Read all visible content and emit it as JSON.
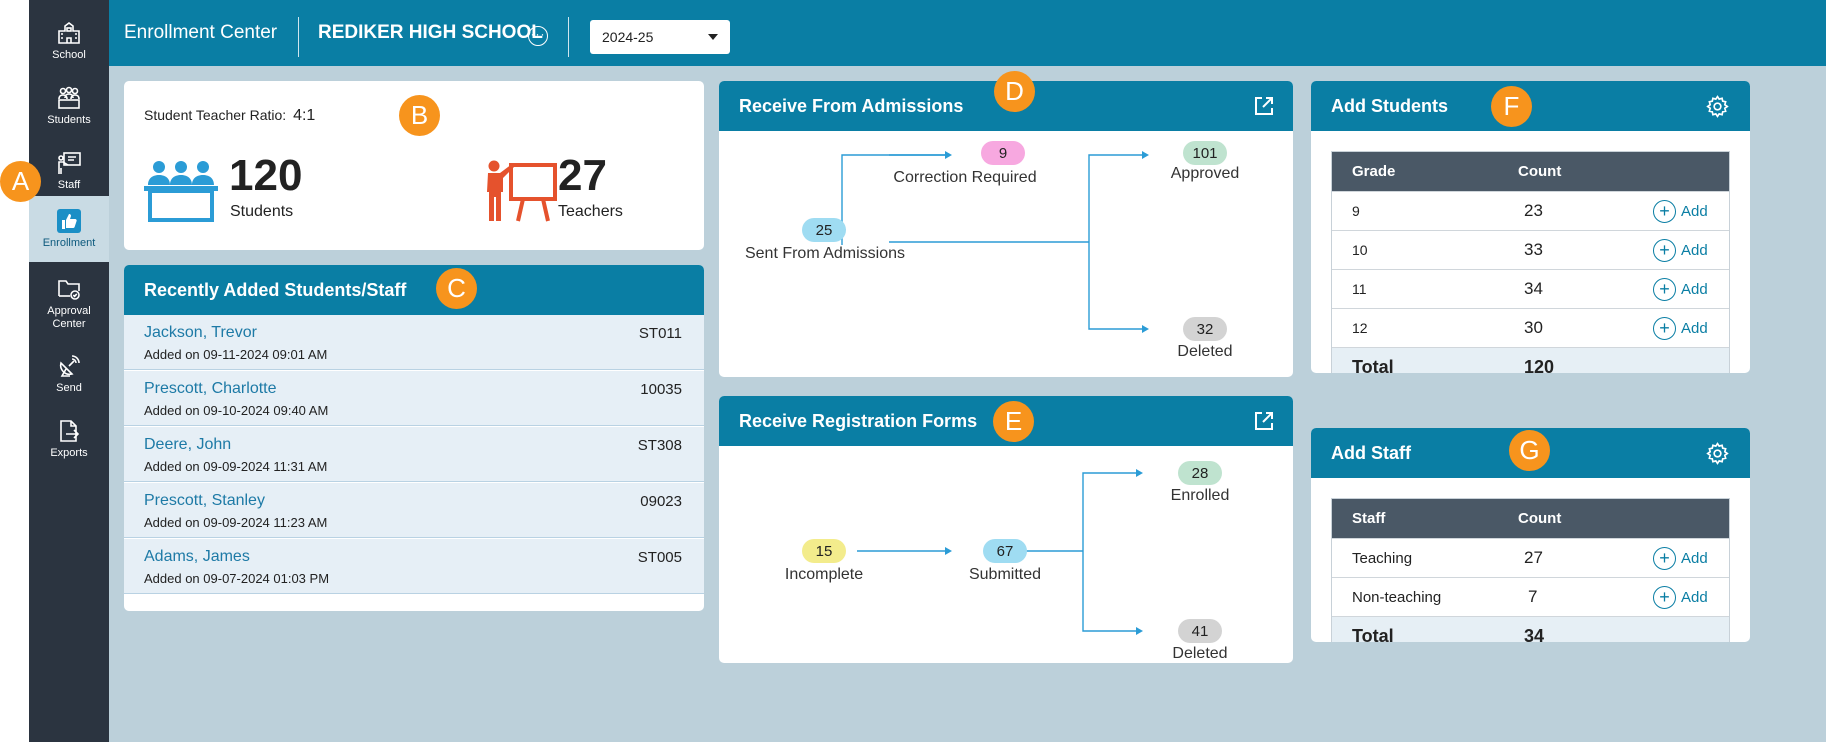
{
  "sidebar": {
    "items": [
      {
        "label": "School",
        "icon": "school-icon"
      },
      {
        "label": "Students",
        "icon": "students-icon"
      },
      {
        "label": "Staff",
        "icon": "staff-icon"
      },
      {
        "label": "Enrollment",
        "icon": "thumbs-up-icon",
        "active": true
      },
      {
        "label": "Approval\nCenter",
        "icon": "folder-check-icon"
      },
      {
        "label": "Send",
        "icon": "satellite-icon"
      },
      {
        "label": "Exports",
        "icon": "export-file-icon"
      }
    ]
  },
  "header": {
    "app_title": "Enrollment Center",
    "school_name": "REDIKER HIGH SCHOOL",
    "year_selected": "2024-25"
  },
  "badges": {
    "a": "A",
    "b": "B",
    "c": "C",
    "d": "D",
    "e": "E",
    "f": "F",
    "g": "G"
  },
  "ratio_card": {
    "ratio_label": "Student Teacher Ratio:",
    "ratio_value": "4:1",
    "students_count": "120",
    "students_label": "Students",
    "teachers_count": "27",
    "teachers_label": "Teachers"
  },
  "recent": {
    "title": "Recently Added Students/Staff",
    "rows": [
      {
        "name": "Jackson, Trevor",
        "id": "ST011",
        "added": "Added on 09-11-2024 09:01 AM"
      },
      {
        "name": "Prescott, Charlotte",
        "id": "10035",
        "added": "Added on 09-10-2024 09:40 AM"
      },
      {
        "name": "Deere, John",
        "id": "ST308",
        "added": "Added on 09-09-2024 11:31 AM"
      },
      {
        "name": "Prescott, Stanley",
        "id": "09023",
        "added": "Added on 09-09-2024 11:23 AM"
      },
      {
        "name": "Adams, James",
        "id": "ST005",
        "added": "Added on 09-07-2024 01:03 PM"
      }
    ]
  },
  "admissions": {
    "title": "Receive From Admissions",
    "correction_count": "9",
    "correction_label": "Correction Required",
    "sent_count": "25",
    "sent_label": "Sent From Admissions",
    "approved_count": "101",
    "approved_label": "Approved",
    "deleted_count": "32",
    "deleted_label": "Deleted"
  },
  "registration": {
    "title": "Receive Registration Forms",
    "incomplete_count": "15",
    "incomplete_label": "Incomplete",
    "submitted_count": "67",
    "submitted_label": "Submitted",
    "enrolled_count": "28",
    "enrolled_label": "Enrolled",
    "deleted_count": "41",
    "deleted_label": "Deleted"
  },
  "add_students": {
    "title": "Add Students",
    "col_grade": "Grade",
    "col_count": "Count",
    "rows": [
      {
        "grade": "9",
        "count": "23",
        "action": "Add"
      },
      {
        "grade": "10",
        "count": "33",
        "action": "Add"
      },
      {
        "grade": "11",
        "count": "34",
        "action": "Add"
      },
      {
        "grade": "12",
        "count": "30",
        "action": "Add"
      }
    ],
    "total_label": "Total",
    "total_value": "120"
  },
  "add_staff": {
    "title": "Add Staff",
    "col_staff": "Staff",
    "col_count": "Count",
    "rows": [
      {
        "type": "Teaching",
        "count": "27",
        "action": "Add"
      },
      {
        "type": "Non-teaching",
        "count": "7",
        "action": "Add"
      }
    ],
    "total_label": "Total",
    "total_value": "34"
  },
  "colors": {
    "brand": "#0a7ea4",
    "sidebar": "#2b3440",
    "badge": "#f7941d",
    "pill_pink": "#f7a8e0",
    "pill_green": "#bfe3cf",
    "pill_blue": "#9fdcf2",
    "pill_gray": "#d3d3d3",
    "pill_yellow": "#f3ec8c"
  }
}
